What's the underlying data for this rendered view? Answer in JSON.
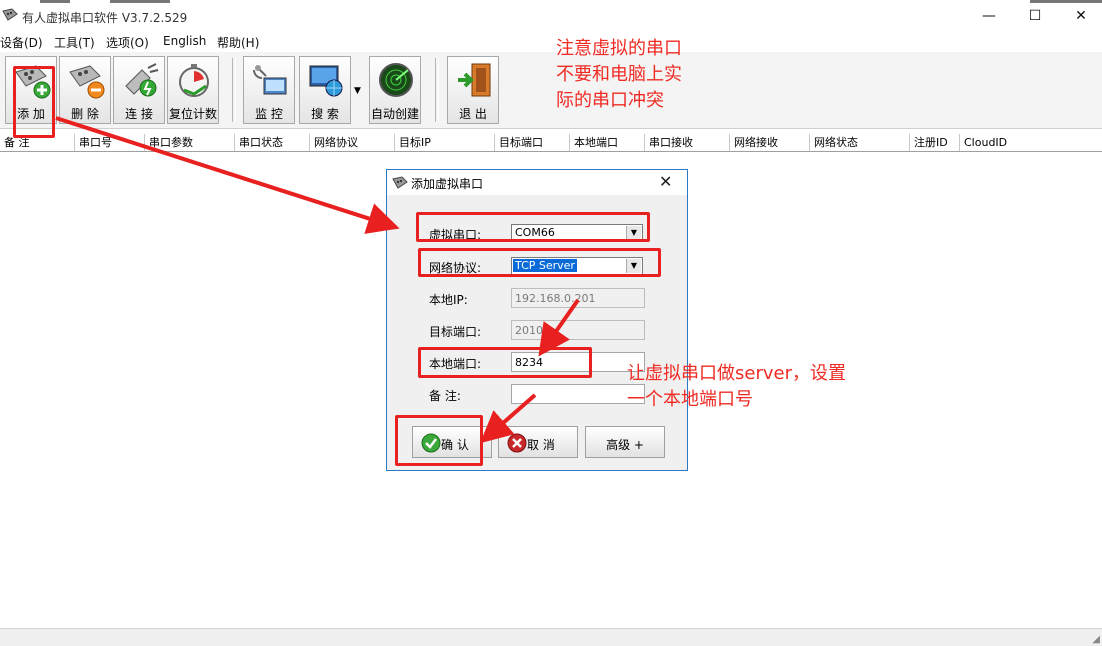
{
  "window": {
    "title": "有人虚拟串口软件 V3.7.2.529",
    "minimize": "—",
    "maximize": "☐",
    "close": "✕"
  },
  "menu": [
    "设备(D)",
    "工具(T)",
    "选项(O)",
    "English",
    "帮助(H)"
  ],
  "toolbar": {
    "add": "添 加",
    "delete": "删 除",
    "connect": "连 接",
    "reset_count": "复位计数",
    "monitor": "监 控",
    "search": "搜 索",
    "auto_create": "自动创建",
    "exit": "退 出",
    "dropdown": "▼"
  },
  "columns": [
    "备 注",
    "串口号",
    "串口参数",
    "串口状态",
    "网络协议",
    "目标IP",
    "目标端口",
    "本地端口",
    "串口接收",
    "网络接收",
    "网络状态",
    "注册ID",
    "CloudID"
  ],
  "dialog": {
    "title": "添加虚拟串口",
    "close": "✕",
    "virtual_port_label": "虚拟串口:",
    "virtual_port_value": "COM66",
    "protocol_label": "网络协议:",
    "protocol_value": "TCP Server",
    "local_ip_label": "本地IP:",
    "local_ip_value": "192.168.0.201",
    "target_port_label": "目标端口:",
    "target_port_value": "20108",
    "local_port_label": "本地端口:",
    "local_port_value": "8234",
    "remark_label": "备  注:",
    "remark_value": "",
    "ok": "确 认",
    "cancel": "取 消",
    "advanced": "高级 +"
  },
  "annotations": {
    "note1": [
      "注意虚拟的串口",
      "不要和电脑上实",
      "际的串口冲突"
    ],
    "note2": [
      "让虚拟串口做server，设置",
      "一个本地端口号"
    ]
  },
  "colors": {
    "annotation_red": "#e8201f",
    "dialog_border": "#2b78c6",
    "selection_blue": "#0a6ad8"
  }
}
